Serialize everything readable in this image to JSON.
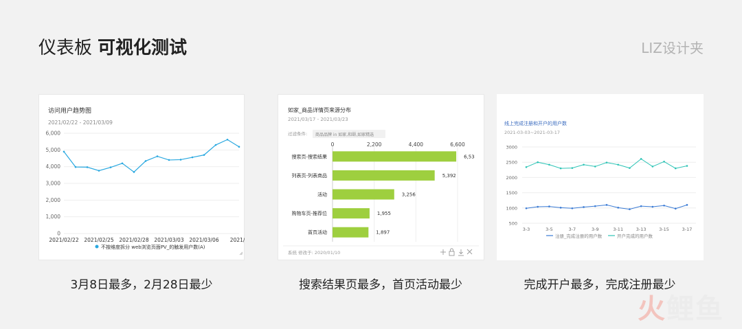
{
  "page": {
    "title_light": "仪表板",
    "title_bold": "可视化测试",
    "brand": "LIZ设计夹",
    "watermark_a": "火",
    "watermark_b": "鲤鱼"
  },
  "captions": [
    "3月8日最多，2月28日最少",
    "搜索结果页最多，首页活动最少",
    "完成开户最多，完成注册最少"
  ],
  "chart1": {
    "title": "访问用户趋势图",
    "subtitle": "2021/02/22 - 2021/03/09",
    "legend": "不按维度拆分 web浏览页面PV_的触发用户数(A)",
    "color": "#29a8e0",
    "chart_data": {
      "type": "line",
      "ylim": [
        0,
        6000
      ],
      "yticks": [
        "6,000",
        "5,000",
        "4,000",
        "3,000",
        "2,000",
        "1,000",
        "0"
      ],
      "xticks": [
        "2021/02/22",
        "2021/02/25",
        "2021/02/28",
        "2021/03/03",
        "2021/03/06",
        "2021/0"
      ],
      "values": [
        4900,
        3980,
        3970,
        3760,
        3960,
        4200,
        3680,
        4340,
        4620,
        4400,
        4420,
        4560,
        4700,
        5300,
        5620,
        5190
      ]
    }
  },
  "chart2": {
    "title": "如家_商品详情页来源分布",
    "subtitle": "2021/03/17 - 2021/03/23",
    "filter_label": "过滤条件:",
    "filter_value": "商品品牌 in 如家,和颐,如家精选",
    "footer": "系统 修改于: 2020/01/10",
    "color": "#9ecf3f",
    "chart_data": {
      "type": "bar",
      "xlim": [
        0,
        6600
      ],
      "xticks": [
        "0",
        "2,200",
        "4,400",
        "6,600"
      ],
      "categories": [
        "搜索页-搜索结果",
        "列表页-列表商品",
        "活动",
        "购物车页-推荐位",
        "首页活动"
      ],
      "values": [
        6530,
        5392,
        3256,
        1955,
        1897
      ],
      "labels": [
        "6,53",
        "5,392",
        "3,256",
        "1,955",
        "1,897"
      ]
    }
  },
  "chart3": {
    "title": "线上完成注册和开户的用户数",
    "subtitle": "2021-03-03~2021-03-17",
    "chart_data": {
      "type": "line",
      "ylim": [
        500,
        3000
      ],
      "yticks": [
        "3000",
        "2500",
        "2000",
        "1500",
        "1000",
        "500"
      ],
      "xticks": [
        "3-3",
        "3-5",
        "3-7",
        "3-9",
        "3-11",
        "3-13",
        "3-15",
        "3-17"
      ],
      "series": [
        {
          "name": "注册_完成注册的用户数",
          "color": "#3a7bd5",
          "values": [
            990,
            1040,
            1050,
            1010,
            990,
            1030,
            1060,
            1100,
            1010,
            960,
            1060,
            1040,
            1080,
            980,
            1100
          ]
        },
        {
          "name": "开户完成的用户数",
          "color": "#2ec4b6",
          "values": [
            2340,
            2500,
            2420,
            2300,
            2310,
            2420,
            2360,
            2490,
            2420,
            2310,
            2610,
            2360,
            2520,
            2300,
            2380
          ]
        }
      ]
    }
  }
}
